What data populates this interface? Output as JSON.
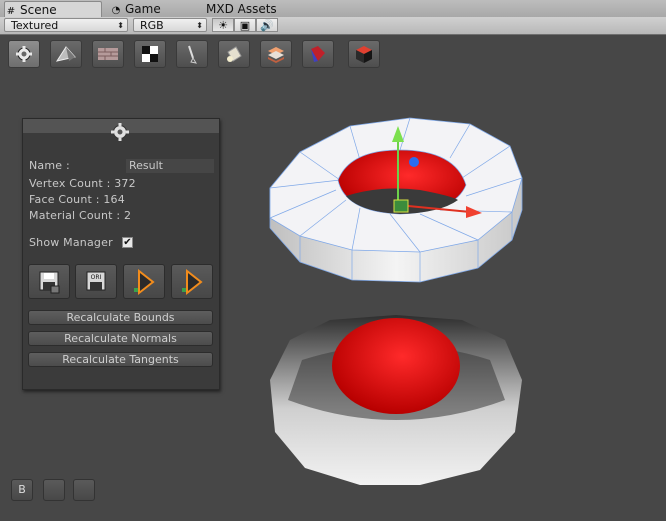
{
  "tabs": [
    {
      "label": "Scene",
      "icon": "grid-icon",
      "active": true
    },
    {
      "label": "Game",
      "icon": "pacman-icon",
      "active": false
    },
    {
      "label": "MXD Assets",
      "icon": "",
      "active": false
    }
  ],
  "toolbar": {
    "render_mode": "Textured",
    "color_mode": "RGB",
    "toggles": [
      "sun-icon",
      "image-icon",
      "speaker-icon"
    ]
  },
  "icon_strip": [
    "gear-icon",
    "pyramid-icon",
    "brick-wall-icon",
    "checker-icon",
    "brush-icon",
    "paint-bucket-icon",
    "stack-icon",
    "magnet-icon",
    "cube-icon"
  ],
  "manager": {
    "name_label": "Name :",
    "name_value": "Result",
    "vertex_count": "Vertex Count : 372",
    "face_count": "Face Count : 164",
    "material_count": "Material Count : 2",
    "show_manager_label": "Show Manager",
    "show_manager_checked": "✔",
    "buttons": [
      "Recalculate Bounds",
      "Recalculate Normals",
      "Recalculate Tangents"
    ],
    "icon_buttons": [
      "save-disk-icon",
      "save-ori-icon",
      "play-export-icon",
      "play-export-alt-icon"
    ],
    "ori_label": "ORI"
  },
  "bottom_buttons": [
    "B",
    "",
    ""
  ],
  "colors": {
    "background": "#474747",
    "panel": "#3b3b3b",
    "accent_red": "#e00000",
    "wire": "#7fa8e8"
  }
}
